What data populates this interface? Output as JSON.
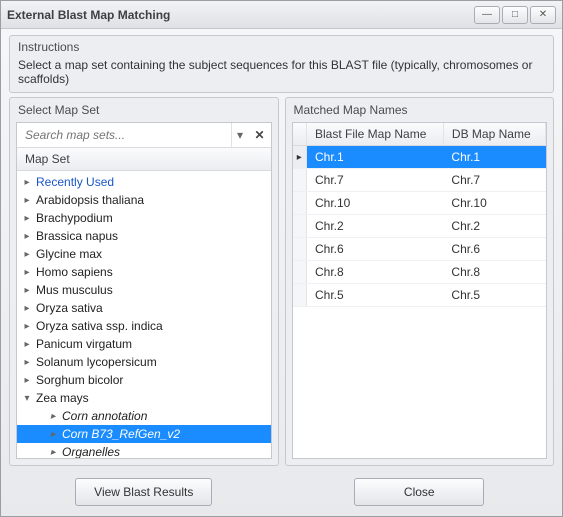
{
  "window": {
    "title": "External Blast Map Matching"
  },
  "instructions": {
    "header": "Instructions",
    "text": "Select a map set containing the subject sequences for this BLAST file (typically, chromosomes or scaffolds)"
  },
  "mapset": {
    "header": "Select Map Set",
    "search_placeholder": "Search map sets...",
    "column": "Map Set",
    "tree": [
      {
        "label": "Recently Used",
        "recent": true
      },
      {
        "label": "Arabidopsis thaliana"
      },
      {
        "label": "Brachypodium"
      },
      {
        "label": "Brassica napus"
      },
      {
        "label": "Glycine max"
      },
      {
        "label": "Homo sapiens"
      },
      {
        "label": "Mus musculus"
      },
      {
        "label": "Oryza sativa"
      },
      {
        "label": "Oryza sativa ssp. indica"
      },
      {
        "label": "Panicum virgatum"
      },
      {
        "label": "Solanum lycopersicum"
      },
      {
        "label": "Sorghum bicolor"
      },
      {
        "label": "Zea mays",
        "expanded": true,
        "children": [
          {
            "label": "Corn annotation"
          },
          {
            "label": "Corn B73_RefGen_v2",
            "selected": true
          },
          {
            "label": "Organelles"
          }
        ]
      }
    ]
  },
  "matched": {
    "header": "Matched Map Names",
    "col1": "Blast File Map Name",
    "col2": "DB Map Name",
    "rows": [
      {
        "a": "Chr.1",
        "b": "Chr.1",
        "selected": true
      },
      {
        "a": "Chr.7",
        "b": "Chr.7"
      },
      {
        "a": "Chr.10",
        "b": "Chr.10"
      },
      {
        "a": "Chr.2",
        "b": "Chr.2"
      },
      {
        "a": "Chr.6",
        "b": "Chr.6"
      },
      {
        "a": "Chr.8",
        "b": "Chr.8"
      },
      {
        "a": "Chr.5",
        "b": "Chr.5"
      }
    ]
  },
  "buttons": {
    "view_results": "View Blast Results",
    "close": "Close"
  },
  "glyphs": {
    "min": "—",
    "max": "□",
    "close": "✕",
    "down": "▾",
    "right": "▸",
    "dot": "▸"
  }
}
